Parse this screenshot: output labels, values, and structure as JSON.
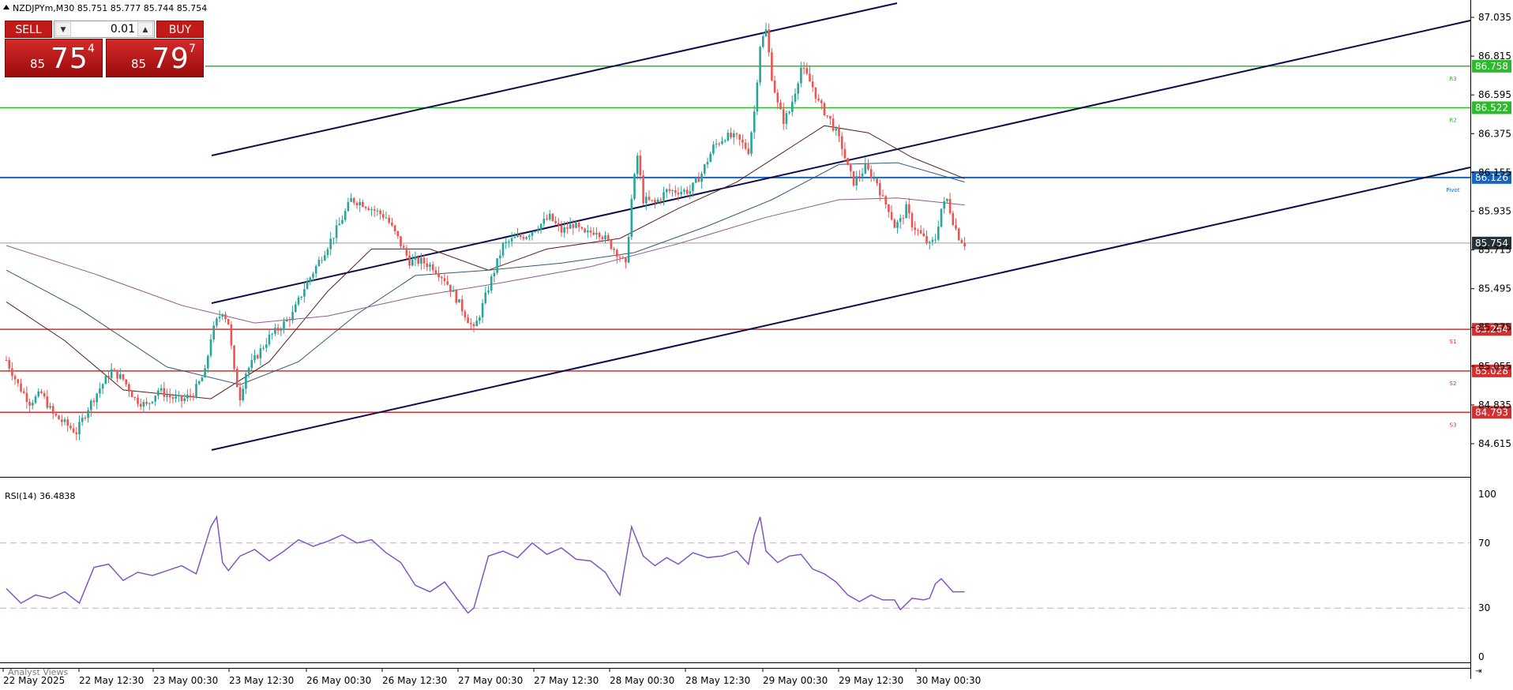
{
  "header": {
    "symbol_line": "NZDJPYm,M30  85.751 85.777 85.744 85.754"
  },
  "trade_panel": {
    "sell_label": "SELL",
    "buy_label": "BUY",
    "lot": "0.01",
    "sell_price": {
      "prefix": "85",
      "big": "75",
      "sup": "4"
    },
    "buy_price": {
      "prefix": "85",
      "big": "79",
      "sup": "7"
    }
  },
  "colors": {
    "bull_candle": "#26a69a",
    "bear_candle": "#ef5350",
    "channel_lines": "#0d0d4d",
    "resistance": "#2eb82e",
    "pivot": "#1565c0",
    "support": "#d32f2f",
    "current_price": "#263238",
    "rsi_line": "#7e57c2",
    "ma_dark": "#5a1f1f",
    "ma_teal": "#345a6e",
    "ma_purple": "#8e5a8e"
  },
  "chart_data": {
    "type": "candlestick",
    "symbol": "NZDJPYm",
    "timeframe": "M30",
    "y_axis": {
      "range": [
        84.5,
        87.1
      ],
      "ticks": [
        "87.035",
        "86.815",
        "86.595",
        "86.375",
        "86.155",
        "85.935",
        "85.715",
        "85.495",
        "85.275",
        "85.055",
        "84.835",
        "84.615"
      ]
    },
    "x_axis": {
      "labels": [
        "22 May 2025",
        "22 May 12:30",
        "23 May 00:30",
        "23 May 12:30",
        "26 May 00:30",
        "26 May 12:30",
        "27 May 00:30",
        "27 May 12:30",
        "28 May 00:30",
        "28 May 12:30",
        "29 May 00:30",
        "29 May 12:30",
        "30 May 00:30"
      ]
    },
    "levels": [
      {
        "name": "R3",
        "value": "86.758",
        "tag": "R3"
      },
      {
        "name": "R2",
        "value": "86.522",
        "tag": "R2"
      },
      {
        "name": "Pivot",
        "value": "86.126",
        "tag": "Pivot"
      },
      {
        "name": "S1",
        "value": "85.264",
        "tag": "S1"
      },
      {
        "name": "S2",
        "value": "85.028",
        "tag": "S2"
      },
      {
        "name": "S3",
        "value": "84.793",
        "tag": "S3"
      }
    ],
    "current_price": "85.754",
    "channel": [
      {
        "from": [
          0,
          85.52
        ],
        "to": [
          230,
          85.46
        ]
      },
      {
        "from": [
          0,
          84.9
        ],
        "to": [
          230,
          84.92
        ]
      },
      {
        "from": [
          0,
          84.72
        ],
        "to": [
          230,
          84.8
        ]
      }
    ],
    "price_path": [
      [
        0,
        85.09
      ],
      [
        4,
        84.95
      ],
      [
        8,
        84.85
      ],
      [
        12,
        84.9
      ],
      [
        16,
        84.78
      ],
      [
        20,
        84.73
      ],
      [
        24,
        84.68
      ],
      [
        28,
        84.82
      ],
      [
        32,
        84.93
      ],
      [
        36,
        85.03
      ],
      [
        40,
        84.98
      ],
      [
        44,
        84.87
      ],
      [
        48,
        84.83
      ],
      [
        52,
        84.92
      ],
      [
        56,
        84.88
      ],
      [
        60,
        84.86
      ],
      [
        64,
        84.9
      ],
      [
        68,
        85.02
      ],
      [
        70,
        85.22
      ],
      [
        72,
        85.31
      ],
      [
        74,
        85.37
      ],
      [
        76,
        85.3
      ],
      [
        78,
        85.02
      ],
      [
        80,
        84.88
      ],
      [
        82,
        85.02
      ],
      [
        86,
        85.12
      ],
      [
        90,
        85.22
      ],
      [
        94,
        85.28
      ],
      [
        98,
        85.35
      ],
      [
        102,
        85.5
      ],
      [
        106,
        85.62
      ],
      [
        110,
        85.74
      ],
      [
        114,
        85.86
      ],
      [
        118,
        86.0
      ],
      [
        122,
        85.98
      ],
      [
        126,
        85.94
      ],
      [
        130,
        85.9
      ],
      [
        134,
        85.78
      ],
      [
        138,
        85.65
      ],
      [
        142,
        85.65
      ],
      [
        146,
        85.62
      ],
      [
        150,
        85.55
      ],
      [
        154,
        85.44
      ],
      [
        158,
        85.32
      ],
      [
        160,
        85.26
      ],
      [
        162,
        85.35
      ],
      [
        166,
        85.55
      ],
      [
        170,
        85.74
      ],
      [
        174,
        85.78
      ],
      [
        178,
        85.8
      ],
      [
        182,
        85.85
      ],
      [
        186,
        85.9
      ],
      [
        190,
        85.82
      ],
      [
        194,
        85.86
      ],
      [
        198,
        85.8
      ],
      [
        202,
        85.83
      ],
      [
        206,
        85.76
      ],
      [
        210,
        85.68
      ],
      [
        212,
        85.62
      ],
      [
        214,
        86.0
      ],
      [
        216,
        86.25
      ],
      [
        218,
        86.0
      ],
      [
        222,
        85.98
      ],
      [
        226,
        86.05
      ],
      [
        230,
        86.05
      ],
      [
        234,
        86.05
      ],
      [
        238,
        86.15
      ],
      [
        242,
        86.3
      ],
      [
        246,
        86.36
      ],
      [
        250,
        86.35
      ],
      [
        254,
        86.28
      ],
      [
        256,
        86.5
      ],
      [
        258,
        86.88
      ],
      [
        260,
        86.96
      ],
      [
        262,
        86.7
      ],
      [
        264,
        86.54
      ],
      [
        266,
        86.45
      ],
      [
        268,
        86.5
      ],
      [
        270,
        86.62
      ],
      [
        272,
        86.75
      ],
      [
        274,
        86.7
      ],
      [
        276,
        86.64
      ],
      [
        278,
        86.55
      ],
      [
        280,
        86.5
      ],
      [
        282,
        86.45
      ],
      [
        284,
        86.38
      ],
      [
        286,
        86.3
      ],
      [
        288,
        86.18
      ],
      [
        290,
        86.1
      ],
      [
        292,
        86.14
      ],
      [
        294,
        86.18
      ],
      [
        296,
        86.14
      ],
      [
        298,
        86.1
      ],
      [
        300,
        86.0
      ],
      [
        302,
        85.95
      ],
      [
        304,
        85.85
      ],
      [
        306,
        85.88
      ],
      [
        308,
        85.95
      ],
      [
        310,
        85.86
      ],
      [
        312,
        85.82
      ],
      [
        314,
        85.78
      ],
      [
        316,
        85.74
      ],
      [
        318,
        85.78
      ],
      [
        320,
        85.95
      ],
      [
        322,
        86.0
      ],
      [
        324,
        85.88
      ],
      [
        326,
        85.79
      ],
      [
        328,
        85.75
      ]
    ],
    "moving_averages": [
      {
        "color_key": "ma_dark",
        "points": [
          [
            0,
            85.42
          ],
          [
            20,
            85.2
          ],
          [
            40,
            84.92
          ],
          [
            70,
            84.87
          ],
          [
            90,
            85.08
          ],
          [
            110,
            85.48
          ],
          [
            125,
            85.72
          ],
          [
            145,
            85.72
          ],
          [
            165,
            85.6
          ],
          [
            185,
            85.72
          ],
          [
            210,
            85.78
          ],
          [
            230,
            85.95
          ],
          [
            250,
            86.1
          ],
          [
            265,
            86.26
          ],
          [
            280,
            86.42
          ],
          [
            295,
            86.38
          ],
          [
            310,
            86.24
          ],
          [
            328,
            86.12
          ]
        ]
      },
      {
        "color_key": "ma_teal",
        "points": [
          [
            0,
            85.6
          ],
          [
            25,
            85.38
          ],
          [
            55,
            85.05
          ],
          [
            80,
            84.95
          ],
          [
            100,
            85.08
          ],
          [
            120,
            85.35
          ],
          [
            140,
            85.57
          ],
          [
            165,
            85.6
          ],
          [
            190,
            85.64
          ],
          [
            215,
            85.7
          ],
          [
            240,
            85.85
          ],
          [
            262,
            86.0
          ],
          [
            285,
            86.2
          ],
          [
            305,
            86.21
          ],
          [
            328,
            86.1
          ]
        ]
      },
      {
        "color_key": "ma_purple",
        "points": [
          [
            0,
            85.74
          ],
          [
            30,
            85.58
          ],
          [
            60,
            85.4
          ],
          [
            85,
            85.3
          ],
          [
            110,
            85.34
          ],
          [
            140,
            85.45
          ],
          [
            170,
            85.53
          ],
          [
            200,
            85.62
          ],
          [
            230,
            85.75
          ],
          [
            260,
            85.9
          ],
          [
            285,
            86.0
          ],
          [
            305,
            86.01
          ],
          [
            328,
            85.97
          ]
        ]
      }
    ],
    "rsi": {
      "label": "RSI(14) 36.4838",
      "ticks": [
        "100",
        "70",
        "30",
        "0"
      ],
      "levels": [
        70,
        30
      ],
      "values": [
        [
          0,
          42
        ],
        [
          5,
          33
        ],
        [
          10,
          38
        ],
        [
          15,
          36
        ],
        [
          20,
          40
        ],
        [
          25,
          33
        ],
        [
          30,
          55
        ],
        [
          35,
          57
        ],
        [
          40,
          47
        ],
        [
          45,
          52
        ],
        [
          50,
          50
        ],
        [
          55,
          53
        ],
        [
          60,
          56
        ],
        [
          65,
          51
        ],
        [
          70,
          80
        ],
        [
          72,
          86
        ],
        [
          74,
          58
        ],
        [
          76,
          53
        ],
        [
          80,
          62
        ],
        [
          85,
          66
        ],
        [
          90,
          59
        ],
        [
          95,
          65
        ],
        [
          100,
          72
        ],
        [
          105,
          68
        ],
        [
          110,
          71
        ],
        [
          115,
          75
        ],
        [
          120,
          70
        ],
        [
          125,
          72
        ],
        [
          130,
          64
        ],
        [
          135,
          58
        ],
        [
          140,
          44
        ],
        [
          145,
          40
        ],
        [
          150,
          46
        ],
        [
          155,
          34
        ],
        [
          158,
          27
        ],
        [
          160,
          30
        ],
        [
          165,
          62
        ],
        [
          170,
          65
        ],
        [
          175,
          61
        ],
        [
          180,
          70
        ],
        [
          185,
          63
        ],
        [
          190,
          67
        ],
        [
          195,
          60
        ],
        [
          200,
          59
        ],
        [
          205,
          52
        ],
        [
          208,
          43
        ],
        [
          210,
          38
        ],
        [
          214,
          80
        ],
        [
          218,
          62
        ],
        [
          222,
          56
        ],
        [
          226,
          61
        ],
        [
          230,
          57
        ],
        [
          235,
          64
        ],
        [
          240,
          61
        ],
        [
          245,
          62
        ],
        [
          250,
          65
        ],
        [
          254,
          57
        ],
        [
          256,
          75
        ],
        [
          258,
          86
        ],
        [
          260,
          65
        ],
        [
          264,
          58
        ],
        [
          268,
          62
        ],
        [
          272,
          63
        ],
        [
          276,
          54
        ],
        [
          280,
          51
        ],
        [
          284,
          46
        ],
        [
          288,
          38
        ],
        [
          292,
          34
        ],
        [
          296,
          38
        ],
        [
          300,
          35
        ],
        [
          304,
          35
        ],
        [
          306,
          29
        ],
        [
          310,
          36
        ],
        [
          314,
          35
        ],
        [
          316,
          36
        ],
        [
          318,
          45
        ],
        [
          320,
          48
        ],
        [
          322,
          44
        ],
        [
          324,
          40
        ],
        [
          328,
          40
        ]
      ]
    },
    "footer_tab": "Analyst Views"
  }
}
